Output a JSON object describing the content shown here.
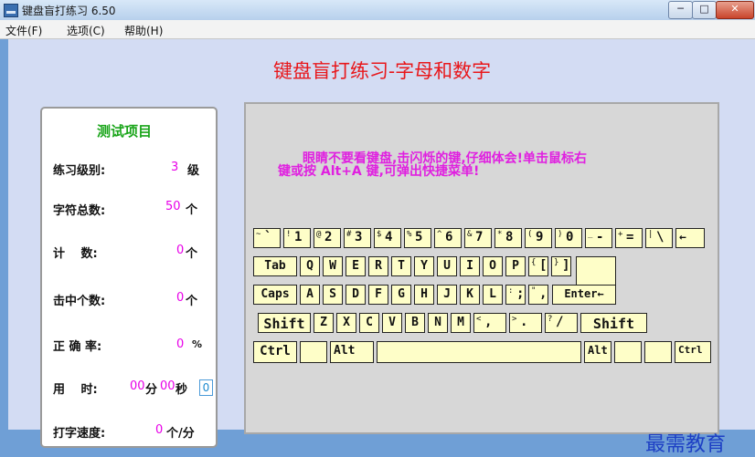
{
  "window": {
    "title": "键盘盲打练习 6.50",
    "min": "─",
    "max": "□",
    "close": "✕"
  },
  "menu": [
    "文件(F)",
    "选项(C)",
    "帮助(H)"
  ],
  "main_title": "键盘盲打练习-字母和数字",
  "stats": {
    "title": "测试项目",
    "level_label": "练习级别:",
    "level_value": "3",
    "level_unit": "级",
    "total_label": "字符总数:",
    "total_value": "50",
    "total_unit": "个",
    "count_label": "计　 数:",
    "count_value": "0",
    "count_unit": "个",
    "hit_label": "击中个数:",
    "hit_value": "0",
    "hit_unit": "个",
    "accuracy_label": "正 确 率:",
    "accuracy_value": "0",
    "accuracy_unit": "%",
    "time_label": "用　 时:",
    "time_min": "00",
    "time_min_unit": "分",
    "time_sec": "00",
    "time_sec_unit": "秒",
    "time_box": "0",
    "speed_label": "打字速度:",
    "speed_value": "0",
    "speed_unit": "个/分"
  },
  "instruction": {
    "line1": "眼睛不要看键盘,击闪烁的键,仔细体会!单击鼠标右",
    "line2": "键或按 Alt+A 键,可弹出快捷菜单!"
  },
  "keys": {
    "row1": [
      {
        "s": "~",
        "m": "`"
      },
      {
        "s": "!",
        "m": "1"
      },
      {
        "s": "@",
        "m": "2"
      },
      {
        "s": "#",
        "m": "3"
      },
      {
        "s": "$",
        "m": "4"
      },
      {
        "s": "%",
        "m": "5"
      },
      {
        "s": "^",
        "m": "6"
      },
      {
        "s": "&",
        "m": "7"
      },
      {
        "s": "*",
        "m": "8"
      },
      {
        "s": "(",
        "m": "9"
      },
      {
        "s": ")",
        "m": "0"
      },
      {
        "s": "_",
        "m": "-"
      },
      {
        "s": "+",
        "m": "="
      },
      {
        "s": "|",
        "m": "\\"
      },
      {
        "s": "",
        "m": "←"
      }
    ],
    "row2": [
      "Tab",
      "Q",
      "W",
      "E",
      "R",
      "T",
      "Y",
      "U",
      "I",
      "O",
      "P"
    ],
    "row2_brackets": [
      {
        "s": "{",
        "m": "["
      },
      {
        "s": "}",
        "m": "]"
      }
    ],
    "enter": "Enter←",
    "row3": [
      "Caps",
      "A",
      "S",
      "D",
      "F",
      "G",
      "H",
      "J",
      "K",
      "L"
    ],
    "row3_punct": [
      {
        "s": ":",
        "m": ";"
      },
      {
        "s": "\"",
        "m": ","
      }
    ],
    "row4": [
      "Shift",
      "Z",
      "X",
      "C",
      "V",
      "B",
      "N",
      "M"
    ],
    "row4_punct": [
      {
        "s": "<",
        "m": ","
      },
      {
        "s": ">",
        "m": "."
      },
      {
        "s": "?",
        "m": "/"
      }
    ],
    "row4_right": "Shift",
    "ctrl_left": "Ctrl",
    "alt_left": "Alt",
    "alt_right": "Alt",
    "ctrl_right": "Ctrl"
  },
  "watermark": "最需教育"
}
